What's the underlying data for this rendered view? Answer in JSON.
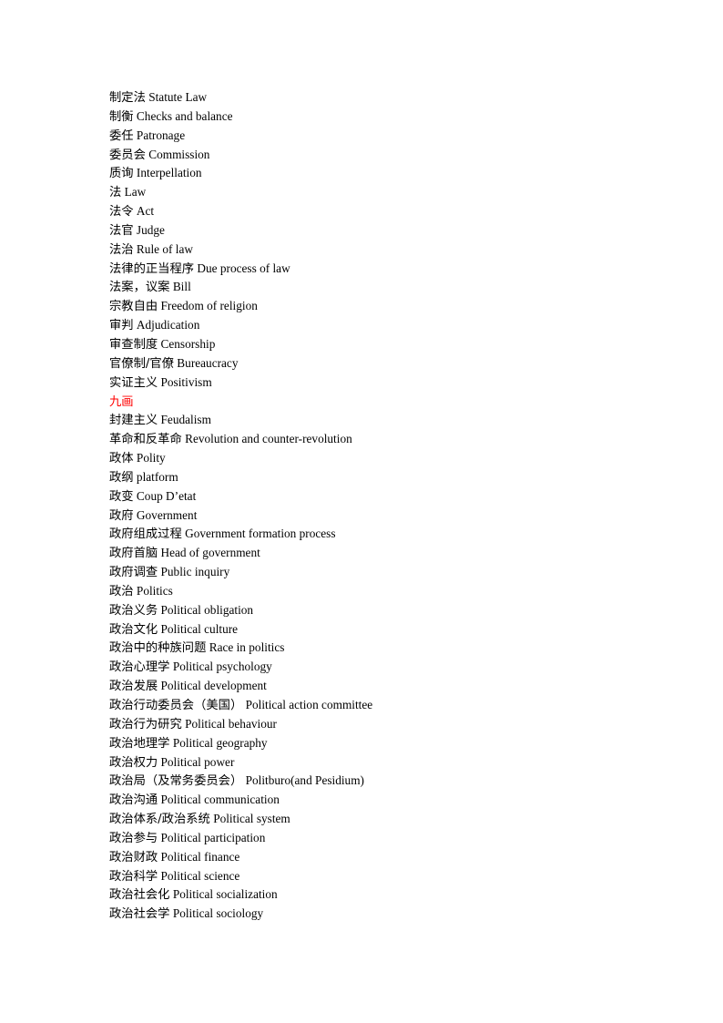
{
  "document": {
    "lines": [
      {
        "zh": "制定法",
        "en": "Statute Law"
      },
      {
        "zh": "制衡",
        "en": "Checks and balance"
      },
      {
        "zh": "委任",
        "en": "Patronage"
      },
      {
        "zh": "委员会",
        "en": "Commission"
      },
      {
        "zh": "质询",
        "en": "Interpellation"
      },
      {
        "zh": "法",
        "en": "Law"
      },
      {
        "zh": "法令",
        "en": "Act"
      },
      {
        "zh": "法官",
        "en": "Judge"
      },
      {
        "zh": "法治",
        "en": "Rule of law"
      },
      {
        "zh": "法律的正当程序",
        "en": "Due process of law"
      },
      {
        "zh": "法案，议案",
        "en": "Bill"
      },
      {
        "zh": "宗教自由",
        "en": "Freedom of religion"
      },
      {
        "zh": "审判",
        "en": "Adjudication"
      },
      {
        "zh": "审查制度",
        "en": "Censorship"
      },
      {
        "zh": "官僚制/官僚",
        "en": "Bureaucracy"
      },
      {
        "zh": "实证主义",
        "en": "Positivism"
      },
      {
        "zh": "九画",
        "en": "",
        "heading": true
      },
      {
        "zh": "封建主义",
        "en": "Feudalism"
      },
      {
        "zh": "革命和反革命",
        "en": "Revolution and counter-revolution"
      },
      {
        "zh": "政体",
        "en": "Polity"
      },
      {
        "zh": "政纲",
        "en": "platform"
      },
      {
        "zh": "政变",
        "en": "Coup D’etat"
      },
      {
        "zh": "政府",
        "en": "Government"
      },
      {
        "zh": "政府组成过程",
        "en": "Government formation process"
      },
      {
        "zh": "政府首脑",
        "en": "Head of government"
      },
      {
        "zh": "政府调查",
        "en": "Public inquiry"
      },
      {
        "zh": "政治",
        "en": "Politics"
      },
      {
        "zh": "政治义务",
        "en": "Political obligation"
      },
      {
        "zh": "政治文化",
        "en": "Political culture"
      },
      {
        "zh": "政治中的种族问题",
        "en": "Race in politics"
      },
      {
        "zh": "政治心理学",
        "en": "Political psychology"
      },
      {
        "zh": "政治发展",
        "en": "Political development"
      },
      {
        "zh": "政治行动委员会（美国）",
        "en": "Political action committee"
      },
      {
        "zh": "政治行为研究",
        "en": "Political behaviour"
      },
      {
        "zh": "政治地理学",
        "en": "Political geography"
      },
      {
        "zh": "政治权力",
        "en": "Political power"
      },
      {
        "zh": "政治局（及常务委员会）",
        "en": "Politburo(and Pesidium)"
      },
      {
        "zh": "政治沟通",
        "en": "Political communication"
      },
      {
        "zh": "政治体系/政治系统",
        "en": "Political system"
      },
      {
        "zh": "政治参与",
        "en": "Political participation"
      },
      {
        "zh": "政治财政",
        "en": "Political finance"
      },
      {
        "zh": "政治科学",
        "en": "Political science"
      },
      {
        "zh": "政治社会化",
        "en": "Political socialization"
      },
      {
        "zh": "政治社会学",
        "en": "Political sociology"
      }
    ]
  },
  "colors": {
    "text": "#000000",
    "heading": "#ff0000",
    "background": "#ffffff"
  }
}
